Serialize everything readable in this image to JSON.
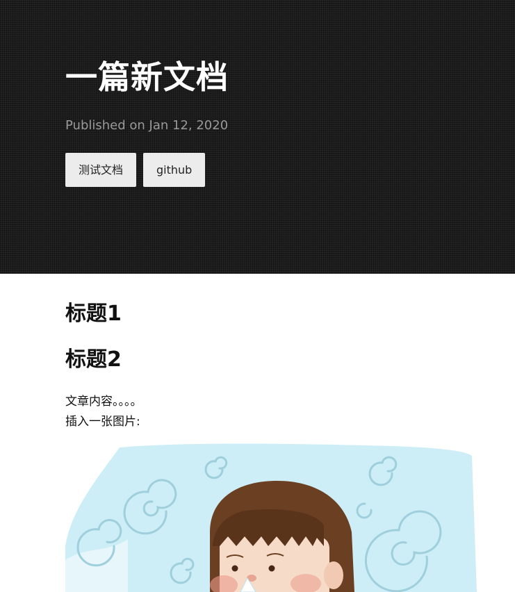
{
  "header": {
    "title": "一篇新文档",
    "published": "Published on Jan 12, 2020",
    "tags": [
      "测试文档",
      "github"
    ]
  },
  "article": {
    "heading1": "标题1",
    "heading2": "标题2",
    "paragraph_lines": [
      "文章内容。。。。",
      "插入一张图片:"
    ]
  },
  "illustration": {
    "icon": "girl-with-tissue-illustration",
    "colors": {
      "sky": "#cdeef6",
      "swirl": "#9fcfdc",
      "hair": "#6b3f22",
      "skin": "#f6dcc8",
      "cheek": "#eb9a8a"
    }
  },
  "colors": {
    "hero_bg": "#1c1c1c",
    "hero_title": "#ffffff",
    "hero_meta": "#9a9a9a",
    "tag_bg": "#ececec"
  }
}
